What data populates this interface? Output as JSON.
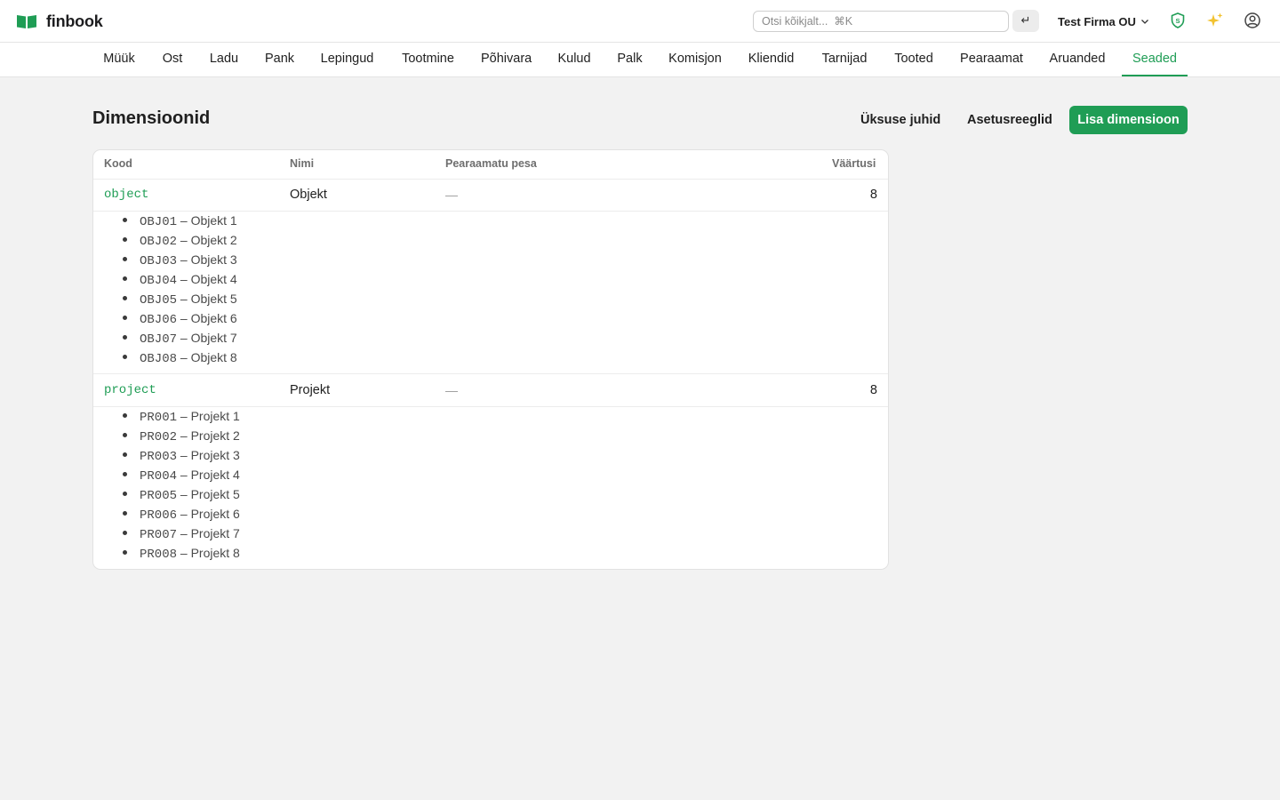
{
  "app": {
    "name": "finbook",
    "brand_color": "#1f9d55"
  },
  "topbar": {
    "search_placeholder": "Otsi kõikjalt...  ⌘K",
    "enter_icon": "↵",
    "company": "Test Firma OU",
    "icons": [
      "shield-icon",
      "sparkle-icon",
      "user-icon"
    ]
  },
  "nav": {
    "items": [
      {
        "label": "Müük"
      },
      {
        "label": "Ost"
      },
      {
        "label": "Ladu"
      },
      {
        "label": "Pank"
      },
      {
        "label": "Lepingud"
      },
      {
        "label": "Tootmine"
      },
      {
        "label": "Põhivara"
      },
      {
        "label": "Kulud"
      },
      {
        "label": "Palk"
      },
      {
        "label": "Komisjon"
      },
      {
        "label": "Kliendid"
      },
      {
        "label": "Tarnijad"
      },
      {
        "label": "Tooted"
      },
      {
        "label": "Pearaamat"
      },
      {
        "label": "Aruanded"
      },
      {
        "label": "Seaded",
        "active": true
      }
    ]
  },
  "page": {
    "title": "Dimensioonid",
    "actions": {
      "unit_managers": "Üksuse juhid",
      "setting_rules": "Asetusreeglid",
      "add_dimension": "Lisa dimensioon"
    }
  },
  "table": {
    "columns": {
      "code": "Kood",
      "name": "Nimi",
      "ledger_nest": "Pearaamatu pesa",
      "values_count": "Väärtusi"
    },
    "rows": [
      {
        "code": "object",
        "name": "Objekt",
        "ledger_nest": "—",
        "values_count": "8",
        "values": [
          {
            "code": "OBJ01",
            "label": "– Objekt 1"
          },
          {
            "code": "OBJ02",
            "label": "– Objekt 2"
          },
          {
            "code": "OBJ03",
            "label": "– Objekt 3"
          },
          {
            "code": "OBJ04",
            "label": "– Objekt 4"
          },
          {
            "code": "OBJ05",
            "label": "– Objekt 5"
          },
          {
            "code": "OBJ06",
            "label": "– Objekt 6"
          },
          {
            "code": "OBJ07",
            "label": "– Objekt 7"
          },
          {
            "code": "OBJ08",
            "label": "– Objekt 8"
          }
        ]
      },
      {
        "code": "project",
        "name": "Projekt",
        "ledger_nest": "—",
        "values_count": "8",
        "values": [
          {
            "code": "PR001",
            "label": "– Projekt 1"
          },
          {
            "code": "PR002",
            "label": "– Projekt 2"
          },
          {
            "code": "PR003",
            "label": "– Projekt 3"
          },
          {
            "code": "PR004",
            "label": "– Projekt 4"
          },
          {
            "code": "PR005",
            "label": "– Projekt 5"
          },
          {
            "code": "PR006",
            "label": "– Projekt 6"
          },
          {
            "code": "PR007",
            "label": "– Projekt 7"
          },
          {
            "code": "PR008",
            "label": "– Projekt 8"
          }
        ]
      }
    ]
  }
}
